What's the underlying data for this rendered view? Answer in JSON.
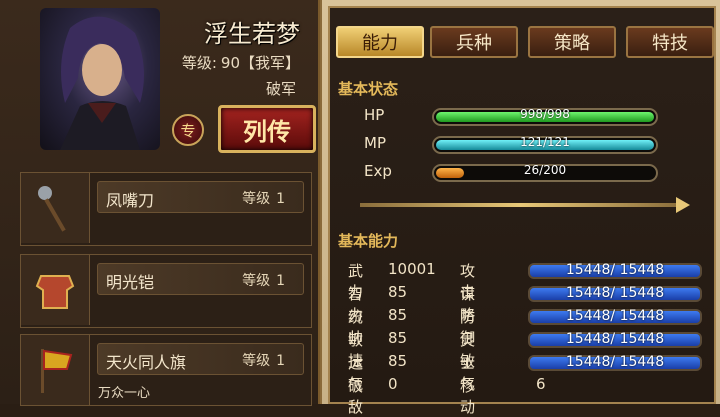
{
  "hero": {
    "name": "浮生若梦",
    "level_label": "等级:",
    "level_value": "90【我军】",
    "faction": "破军",
    "special_label": "专",
    "bio_button": "列传"
  },
  "equipment": [
    {
      "name": "凤嘴刀",
      "level_label": "等级",
      "level": "1",
      "icon": "blade-weapon-icon"
    },
    {
      "name": "明光铠",
      "level_label": "等级",
      "level": "1",
      "icon": "armor-icon"
    },
    {
      "name": "天火同人旗",
      "level_label": "等级",
      "level": "1",
      "icon": "flag-icon",
      "subtitle": "万众一心"
    }
  ],
  "tabs": [
    {
      "label": "能力",
      "active": true
    },
    {
      "label": "兵种",
      "active": false
    },
    {
      "label": "策略",
      "active": false
    },
    {
      "label": "特技",
      "active": false
    }
  ],
  "basic_status": {
    "title": "基本状态",
    "bars": [
      {
        "label": "HP",
        "text": "998/998",
        "fraction": 1.0,
        "color": "#3fd13f"
      },
      {
        "label": "MP",
        "text": "121/121",
        "fraction": 1.0,
        "color": "#2bc9d6"
      },
      {
        "label": "Exp",
        "text": "26/200",
        "fraction": 0.13,
        "color": "#f08a1e"
      }
    ]
  },
  "basic_ability": {
    "title": "基本能力",
    "rows": [
      {
        "name": "武力",
        "value": "10001",
        "name2": "攻击",
        "bar": "15448/ 15448"
      },
      {
        "name": "智力",
        "value": "85",
        "name2": "谋略",
        "bar": "15448/ 15448"
      },
      {
        "name": "统帅",
        "value": "85",
        "name2": "防御",
        "bar": "15448/ 15448"
      },
      {
        "name": "敏捷",
        "value": "85",
        "name2": "灵敏",
        "bar": "15448/ 15448"
      },
      {
        "name": "运气",
        "value": "85",
        "name2": "士气",
        "bar": "15448/ 15448"
      },
      {
        "name": "破敌",
        "value": "0",
        "name2": "移动",
        "move": "6"
      }
    ]
  }
}
